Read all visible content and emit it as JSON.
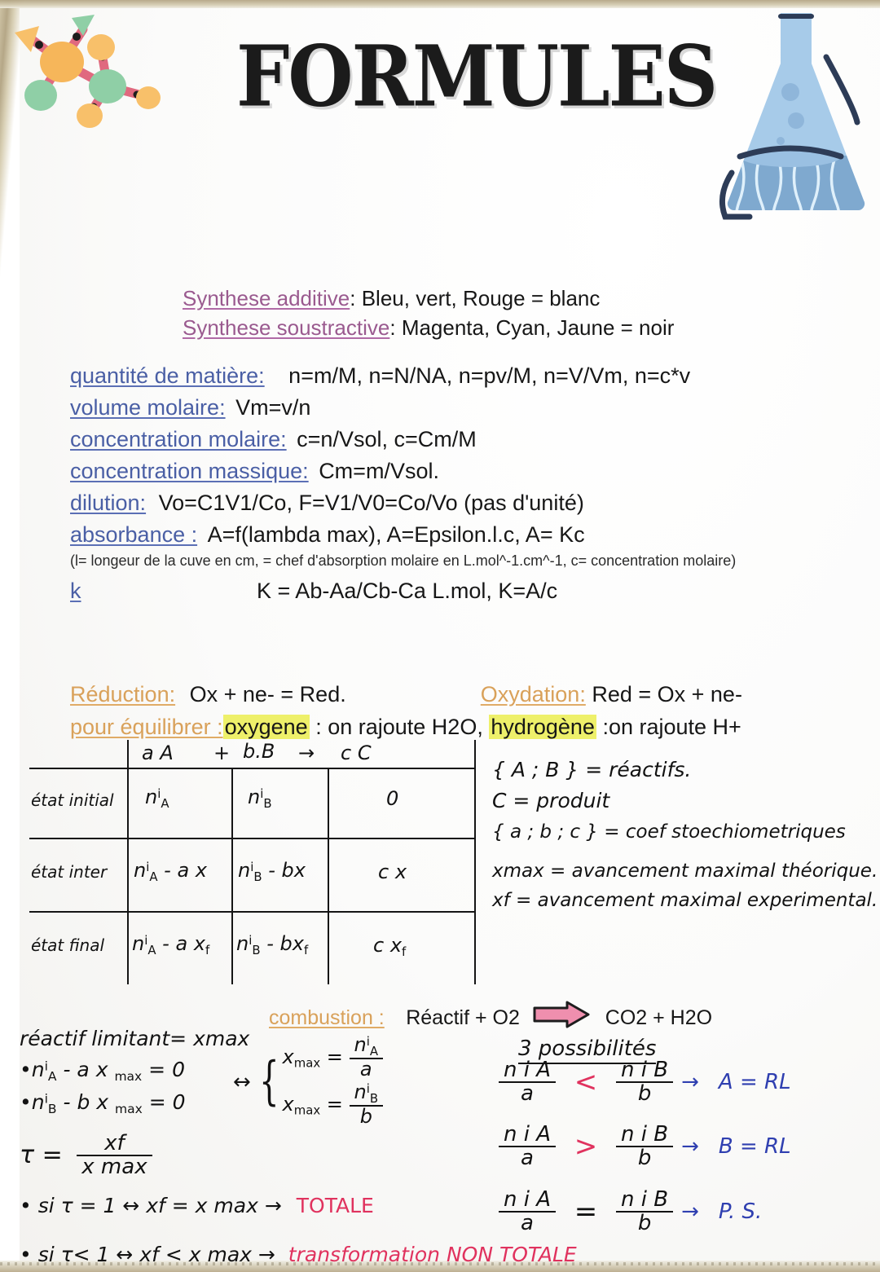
{
  "header": {
    "title": "FORMULES",
    "molecule_icon": "molecule-icon",
    "flask_icon": "erlenmeyer-flask-icon"
  },
  "synthesis": [
    {
      "label": "Synthese additive",
      "sep": ": ",
      "value": "Bleu, vert, Rouge = blanc"
    },
    {
      "label": "Synthese soustractive",
      "sep": ": ",
      "value": "Magenta, Cyan, Jaune = noir"
    }
  ],
  "formulas": [
    {
      "label": "quantité de matière:",
      "value": "n=m/M, n=N/NA, n=pv/M, n=V/Vm, n=c*v"
    },
    {
      "label": "volume molaire:",
      "value": "Vm=v/n"
    },
    {
      "label": "concentration molaire:",
      "value": "c=n/Vsol, c=Cm/M"
    },
    {
      "label": "concentration massique:",
      "value": "Cm=m/Vsol."
    },
    {
      "label": "dilution:",
      "value": "Vo=C1V1/Co,  F=V1/V0=Co/Vo (pas d'unité)"
    },
    {
      "label": "absorbance :",
      "value": "A=f(lambda max),  A=Epsilon.l.c, A= Kc"
    }
  ],
  "absorbance_note": "(l= longeur de la cuve en cm,   = chef d'absorption molaire en L.mol^-1.cm^-1, c= concentration molaire)",
  "k_line": {
    "label": "k",
    "value": "K = Ab-Aa/Cb-Ca L.mol,  K=A/c"
  },
  "redox": {
    "reduction_label": "Réduction:",
    "reduction_value": "Ox + ne- = Red.",
    "oxydation_label": "Oxydation:",
    "oxydation_value": "Red = Ox + ne-",
    "equilibrer_label": "pour équilibrer :",
    "highlight_oxygene": "oxygene",
    "after_oxygene": " : on rajoute H2O, ",
    "highlight_hydrogene": "hydrogène",
    "after_hydrogene": " :on rajoute H+"
  },
  "table": {
    "header": {
      "a": "a A",
      "plus": "+",
      "b": "b.B",
      "arrow": "→",
      "c": "c C"
    },
    "rows": [
      {
        "label": "état initial",
        "colA": "n i A",
        "colB": "n i B",
        "colC": "0"
      },
      {
        "label": "état inter",
        "colA": "n i A - a x",
        "colB": "n i B - bx",
        "colC": "c x"
      },
      {
        "label": "état final",
        "colA": "n i A - a xf",
        "colB": "n i B - bxf",
        "colC": "c xf"
      }
    ]
  },
  "legend": [
    "{ A ; B } = réactifs.",
    "C =  produit",
    "{ a ; b ; c } = coef stoechiometriques",
    "xmax = avancement maximal théorique.",
    "xf = avancement maximal experimental."
  ],
  "combustion": {
    "label": "combustion :",
    "left": "Réactif + O2",
    "arrow": "thick-pink-arrow-icon",
    "right": "CO2 + H2O"
  },
  "bottom_left": {
    "title": "réactif limitant= xmax",
    "eq1": "• n i A -  a x max = 0",
    "eq2": "• n i B -  b x max = 0",
    "equiv": "↔",
    "sys1_left": "x max =",
    "sys1_num": "n i A",
    "sys1_den": "a",
    "sys2_left": "x max =",
    "sys2_num": "n i B",
    "sys2_den": "b",
    "tau_label": "τ =",
    "tau_num": "xf",
    "tau_den": "x max",
    "case1": "• si τ = 1 ↔ xf = x max →",
    "case1_result": "TOTALE",
    "case2": "• si τ< 1 ↔ xf < x max →",
    "case2_result": "transformation NON TOTALE"
  },
  "possibilities": {
    "title": "3 possibilités",
    "rows": [
      {
        "num_left": "n i A",
        "den_left": "a",
        "op": "<",
        "num_right": "n i B",
        "den_right": "b",
        "arrow": "→",
        "result": "A = RL"
      },
      {
        "num_left": "n i A",
        "den_left": "a",
        "op": ">",
        "num_right": "n i B",
        "den_right": "b",
        "arrow": "→",
        "result": "B = RL"
      },
      {
        "num_left": "n i A",
        "den_left": "a",
        "op": "=",
        "num_right": "n i B",
        "den_right": "b",
        "arrow": "→",
        "result": "P. S."
      }
    ]
  },
  "colors": {
    "pink_underline": "#b06aa6",
    "blue_underline": "#5b6fb5",
    "orange_underline": "#e0ab66",
    "highlight_yellow": "#eef06a",
    "red_ink": "#e0325e",
    "blue_ink": "#2f3fb0",
    "flask_blue": "#9fc6e8",
    "arrow_pink": "#ef8fae"
  }
}
